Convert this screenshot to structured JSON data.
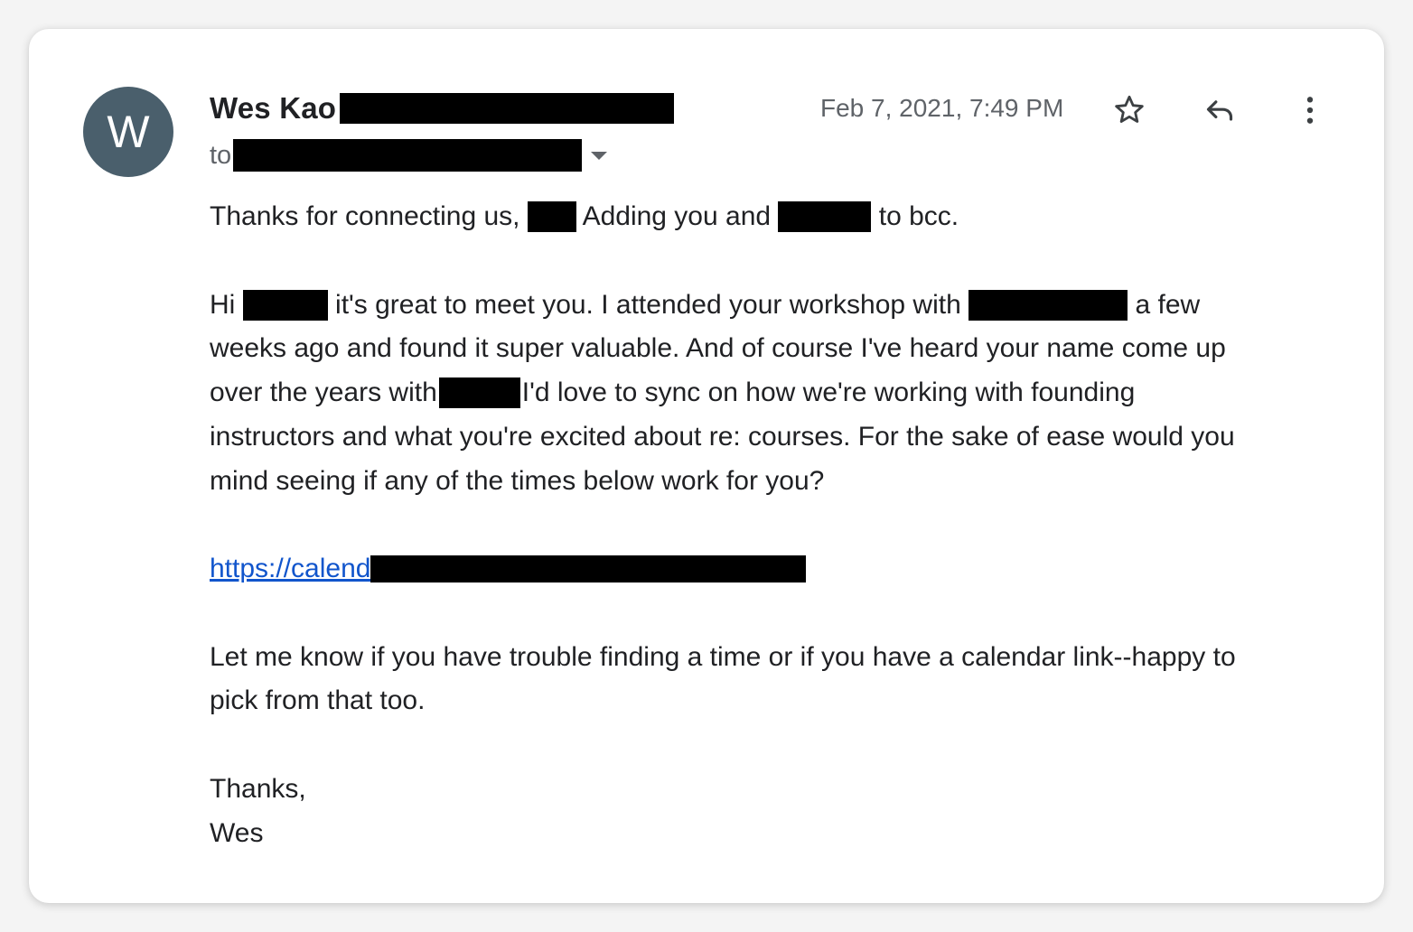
{
  "sender": {
    "avatar_letter": "W",
    "name": "Wes Kao"
  },
  "recipient": {
    "to_label": "to"
  },
  "timestamp": "Feb 7, 2021, 7:49 PM",
  "actions": {
    "star_icon": "star-icon",
    "reply_icon": "reply-icon",
    "more_icon": "more-vert-icon"
  },
  "body": {
    "p1_a": "Thanks for connecting us,",
    "p1_b": "Adding you and",
    "p1_c": "to bcc.",
    "p2_l1_a": "Hi",
    "p2_l1_b": "it's great to meet you. I attended your workshop with",
    "p2_l1_c": "a few",
    "p2_l2": "weeks ago and found it super valuable. And of course I've heard your name come up",
    "p2_l3_a": "over the years with",
    "p2_l3_b": "I'd love to sync on how we're working with founding",
    "p2_l4": "instructors and what you're excited about re: courses. For the sake of ease would you",
    "p2_l5": "mind seeing if any of the times below work for you?",
    "link_text": "https://calend",
    "p3_l1": "Let me know if you have trouble finding a time or if you have a calendar link--happy to",
    "p3_l2": "pick from that too.",
    "closing": "Thanks,",
    "signature": "Wes"
  },
  "colors": {
    "avatar_bg": "#4a5f6c",
    "text": "#202124",
    "secondary_text": "#5f6368",
    "link": "#1155cc",
    "redaction": "#000000"
  }
}
